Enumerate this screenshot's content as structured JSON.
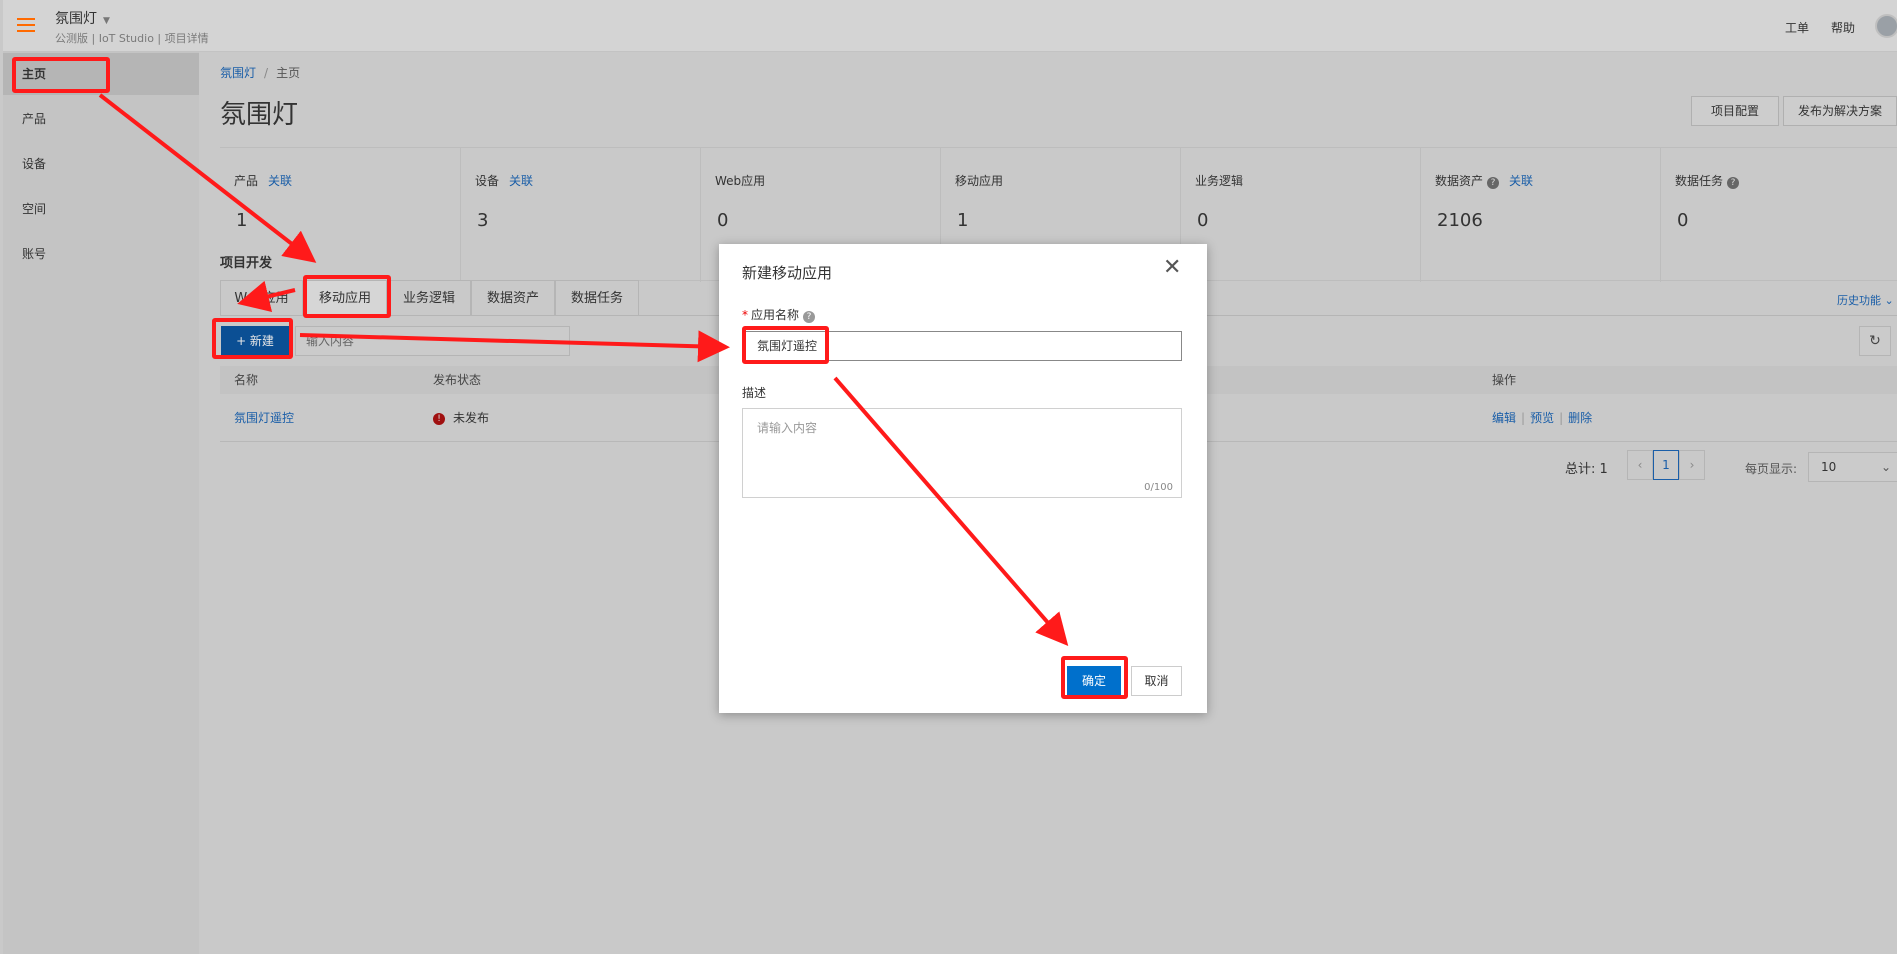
{
  "topbar": {
    "title": "氛围灯",
    "subtitle": "公测版 | IoT Studio | 项目详情",
    "links": [
      "工单",
      "帮助"
    ]
  },
  "sidebar": {
    "items": [
      {
        "label": "主页",
        "active": true
      },
      {
        "label": "产品",
        "active": false
      },
      {
        "label": "设备",
        "active": false
      },
      {
        "label": "空间",
        "active": false
      },
      {
        "label": "账号",
        "active": false
      }
    ]
  },
  "main": {
    "breadcrumb": {
      "root": "氛围灯",
      "sep": "/",
      "current": "主页"
    },
    "title": "氛围灯",
    "header_buttons": [
      "项目配置",
      "发布为解决方案"
    ],
    "stats": [
      {
        "label": "产品",
        "link": "关联",
        "help": false,
        "value": "1"
      },
      {
        "label": "设备",
        "link": "关联",
        "help": false,
        "value": "3"
      },
      {
        "label": "Web应用",
        "link": "",
        "help": false,
        "value": "0"
      },
      {
        "label": "移动应用",
        "link": "",
        "help": false,
        "value": "1"
      },
      {
        "label": "业务逻辑",
        "link": "",
        "help": false,
        "value": "0"
      },
      {
        "label": "数据资产",
        "link": "关联",
        "help": true,
        "value": "2106"
      },
      {
        "label": "数据任务",
        "link": "",
        "help": true,
        "value": "0"
      }
    ],
    "section_title": "项目开发",
    "history_link": "历史功能",
    "tabs": [
      "Web应用",
      "移动应用",
      "业务逻辑",
      "数据资产",
      "数据任务"
    ],
    "active_tab": "移动应用",
    "new_button": "+ 新建",
    "search_placeholder": "输入内容",
    "refresh_icon": "refresh-icon",
    "table": {
      "columns": [
        "名称",
        "发布状态",
        "操作"
      ],
      "rows": [
        {
          "name": "氛围灯遥控",
          "status": "未发布",
          "ops": [
            "编辑",
            "预览",
            "删除"
          ]
        }
      ]
    },
    "pagination": {
      "total_label": "总计: 1",
      "current_page": "1",
      "page_size_label": "每页显示:",
      "page_size": "10"
    }
  },
  "modal": {
    "title": "新建移动应用",
    "name_label": "应用名称",
    "name_value": "氛围灯遥控",
    "desc_label": "描述",
    "desc_placeholder": "请输入内容",
    "desc_counter": "0/100",
    "ok_label": "确定",
    "cancel_label": "取消"
  },
  "colors": {
    "annotation": "#ff1a1a",
    "primary": "#0070cc",
    "link": "#1a5ea8",
    "accent": "#ff6a00"
  }
}
